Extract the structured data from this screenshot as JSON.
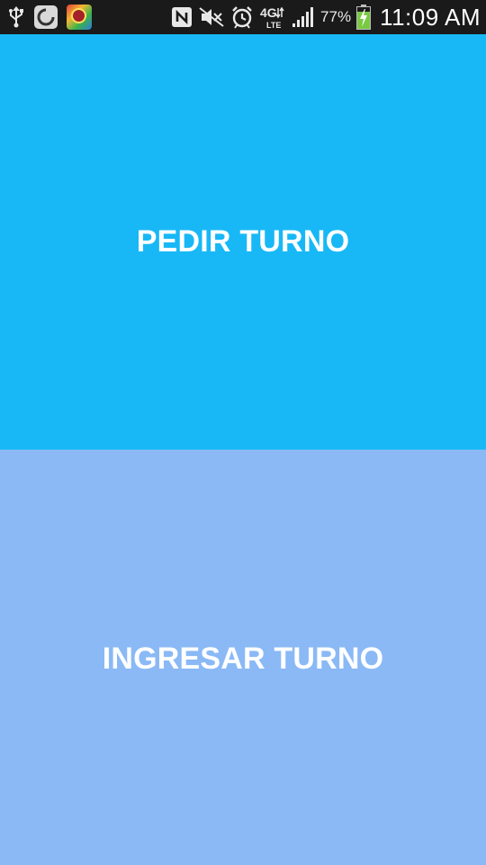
{
  "status_bar": {
    "icons_left": [
      "usb-icon",
      "app-icon",
      "game-icon"
    ],
    "icons_right": [
      "nfc-icon",
      "mute-icon",
      "alarm-icon",
      "lte-icon",
      "signal-icon",
      "battery-icon"
    ],
    "network_label": "4G",
    "network_sublabel": "LTE",
    "battery_percent": "77%",
    "time": "11:09 AM",
    "colors": {
      "background": "#1a1a1a",
      "text": "#e8e8e8",
      "battery_fill": "#7ac943"
    }
  },
  "main": {
    "buttons": [
      {
        "label": "PEDIR TURNO",
        "color": "#18b8f6"
      },
      {
        "label": "INGRESAR TURNO",
        "color": "#8ab9f6"
      }
    ]
  }
}
